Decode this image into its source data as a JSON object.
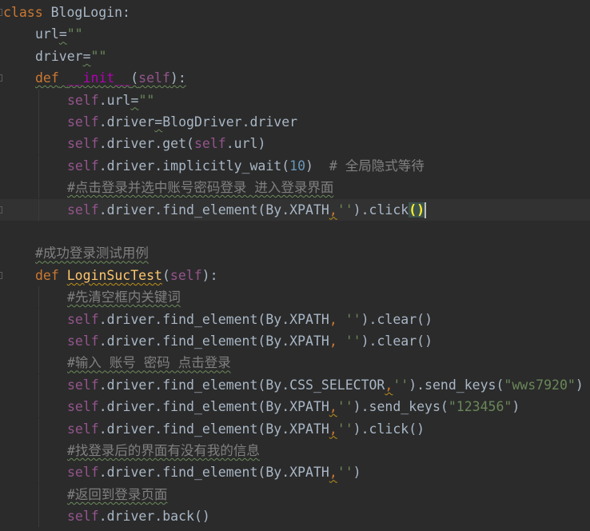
{
  "editor": {
    "lines": [
      {
        "segments": [
          {
            "t": "class",
            "c": "kw"
          },
          {
            "t": " BlogLogin:",
            "c": "pl"
          }
        ]
      },
      {
        "segments": [
          {
            "t": "url",
            "c": "pl"
          },
          {
            "t": "=",
            "c": "pl",
            "u": "wavy"
          },
          {
            "t": "\"\"",
            "c": "str"
          }
        ]
      },
      {
        "segments": [
          {
            "t": "driver",
            "c": "pl"
          },
          {
            "t": "=",
            "c": "pl",
            "u": "wavy"
          },
          {
            "t": "\"\"",
            "c": "str"
          }
        ]
      },
      {
        "segments": [
          {
            "t": "def",
            "c": "kw",
            "u": "wavy"
          },
          {
            "t": " ",
            "c": "pl",
            "u": "wavy"
          },
          {
            "t": "__init__",
            "c": "magic",
            "u": "wavy"
          },
          {
            "t": "(",
            "c": "pl",
            "u": "wavy"
          },
          {
            "t": "self",
            "c": "self",
            "u": "wavy"
          },
          {
            "t": "):",
            "c": "pl",
            "u": "wavy"
          }
        ]
      },
      {
        "segments": [
          {
            "t": "self",
            "c": "self"
          },
          {
            "t": ".url",
            "c": "pl"
          },
          {
            "t": "=",
            "c": "pl",
            "u": "wavy"
          },
          {
            "t": "\"\"",
            "c": "str"
          }
        ]
      },
      {
        "segments": [
          {
            "t": "self",
            "c": "self"
          },
          {
            "t": ".driver",
            "c": "pl"
          },
          {
            "t": "=",
            "c": "pl",
            "u": "wavy"
          },
          {
            "t": "BlogDriver.driver",
            "c": "pl"
          }
        ]
      },
      {
        "segments": [
          {
            "t": "self",
            "c": "self"
          },
          {
            "t": ".driver.get(",
            "c": "pl"
          },
          {
            "t": "self",
            "c": "self"
          },
          {
            "t": ".url)",
            "c": "pl"
          }
        ]
      },
      {
        "segments": [
          {
            "t": "self",
            "c": "self"
          },
          {
            "t": ".driver.implicitly_wait(",
            "c": "pl"
          },
          {
            "t": "10",
            "c": "num"
          },
          {
            "t": ")  ",
            "c": "pl"
          },
          {
            "t": "# 全局隐式等待",
            "c": "cmt"
          }
        ]
      },
      {
        "segments": [
          {
            "t": "#点击登录并选中账号密码登录 进入登录界面",
            "c": "cmt",
            "u": "wavy"
          }
        ]
      },
      {
        "segments": [
          {
            "t": "self",
            "c": "self"
          },
          {
            "t": ".driver.find_element(By.XPATH",
            "c": "pl"
          },
          {
            "t": ",",
            "c": "kw",
            "u": "wavy-o"
          },
          {
            "t": "''",
            "c": "str"
          },
          {
            "t": ").click",
            "c": "pl"
          },
          {
            "t": "()",
            "c": "hl"
          }
        ]
      },
      {
        "segments": []
      },
      {
        "segments": [
          {
            "t": "#成功登录测试用例",
            "c": "cmt",
            "u": "wavy"
          }
        ]
      },
      {
        "segments": [
          {
            "t": "def",
            "c": "kw"
          },
          {
            "t": " ",
            "c": "pl"
          },
          {
            "t": "LoginSucTest",
            "c": "fn",
            "u": "wavy-o"
          },
          {
            "t": "(",
            "c": "pl"
          },
          {
            "t": "self",
            "c": "self"
          },
          {
            "t": "):",
            "c": "pl"
          }
        ]
      },
      {
        "segments": [
          {
            "t": "#先清空框内关键词",
            "c": "cmt",
            "u": "wavy"
          }
        ]
      },
      {
        "segments": [
          {
            "t": "self",
            "c": "self"
          },
          {
            "t": ".driver.find_element(By.XPATH",
            "c": "pl"
          },
          {
            "t": ", ",
            "c": "kw"
          },
          {
            "t": "''",
            "c": "str"
          },
          {
            "t": ").clear()",
            "c": "pl"
          }
        ]
      },
      {
        "segments": [
          {
            "t": "self",
            "c": "self"
          },
          {
            "t": ".driver.find_element(By.XPATH",
            "c": "pl"
          },
          {
            "t": ", ",
            "c": "kw"
          },
          {
            "t": "''",
            "c": "str"
          },
          {
            "t": ").clear()",
            "c": "pl"
          }
        ]
      },
      {
        "segments": [
          {
            "t": "#输入 账号 密码 点击登录",
            "c": "cmt",
            "u": "wavy"
          }
        ]
      },
      {
        "segments": [
          {
            "t": "self",
            "c": "self"
          },
          {
            "t": ".driver.find_element(By.CSS_SELECTOR",
            "c": "pl"
          },
          {
            "t": ",",
            "c": "kw",
            "u": "wavy-o"
          },
          {
            "t": "''",
            "c": "str"
          },
          {
            "t": ").send_keys(",
            "c": "pl"
          },
          {
            "t": "\"wws7920\"",
            "c": "str"
          },
          {
            "t": ")",
            "c": "pl"
          }
        ]
      },
      {
        "segments": [
          {
            "t": "self",
            "c": "self"
          },
          {
            "t": ".driver.find_element(By.XPATH",
            "c": "pl"
          },
          {
            "t": ",",
            "c": "kw",
            "u": "wavy-o"
          },
          {
            "t": "''",
            "c": "str"
          },
          {
            "t": ").send_keys(",
            "c": "pl"
          },
          {
            "t": "\"123456\"",
            "c": "str"
          },
          {
            "t": ")",
            "c": "pl"
          }
        ]
      },
      {
        "segments": [
          {
            "t": "self",
            "c": "self"
          },
          {
            "t": ".driver.find_element(By.XPATH",
            "c": "pl"
          },
          {
            "t": ",",
            "c": "kw",
            "u": "wavy-o"
          },
          {
            "t": "''",
            "c": "str"
          },
          {
            "t": ").click()",
            "c": "pl"
          }
        ]
      },
      {
        "segments": [
          {
            "t": "#找登录后的界面有没有我的信息",
            "c": "cmt",
            "u": "wavy"
          }
        ]
      },
      {
        "segments": [
          {
            "t": "self",
            "c": "self"
          },
          {
            "t": ".driver.find_element(By.XPATH",
            "c": "pl"
          },
          {
            "t": ",",
            "c": "kw",
            "u": "wavy-o"
          },
          {
            "t": "''",
            "c": "str"
          },
          {
            "t": ")",
            "c": "pl"
          }
        ]
      },
      {
        "segments": [
          {
            "t": "#返回到登录页面",
            "c": "cmt",
            "u": "wavy"
          }
        ]
      },
      {
        "segments": [
          {
            "t": "self",
            "c": "self"
          },
          {
            "t": ".driver.back()",
            "c": "pl"
          }
        ]
      }
    ]
  }
}
